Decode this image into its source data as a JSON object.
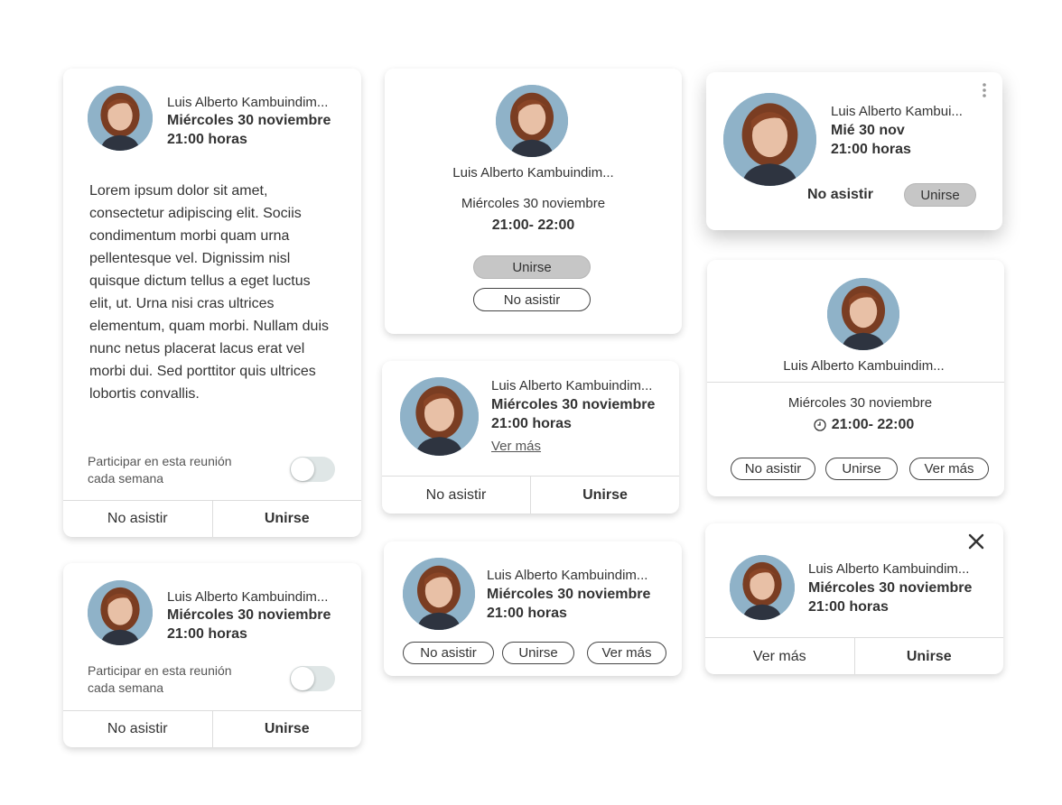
{
  "person": {
    "name_a": "Luis Alberto Kambuindim...",
    "name_b": "Luis Alberto Kambui...",
    "avatar_icon": "user-photo"
  },
  "date": {
    "full_bold": "Miércoles 30 noviembre",
    "full": "Miércoles 30 noviembre",
    "short": "Mié 30 nov"
  },
  "time": {
    "hour": "21:00 horas",
    "range": "21:00- 22:00"
  },
  "description": "Lorem ipsum dolor sit amet, consectetur adipiscing elit. Sociis condimentum morbi quam urna pellentesque vel. Dignissim nisl quisque dictum tellus a eget luctus elit, ut. Urna nisi cras ultrices elementum, quam morbi. Nullam duis nunc netus placerat lacus erat vel morbi dui. Sed porttitor quis ultrices lobortis convallis.",
  "recurring": {
    "label_line1": "Participar en esta reunión",
    "label_line2": "cada semana",
    "enabled": false
  },
  "actions": {
    "decline": "No asistir",
    "join": "Unirse",
    "more": "Ver más"
  },
  "colors": {
    "filled_pill": "#c6c6c6",
    "text": "#333333",
    "divider": "#dcdcdc"
  }
}
